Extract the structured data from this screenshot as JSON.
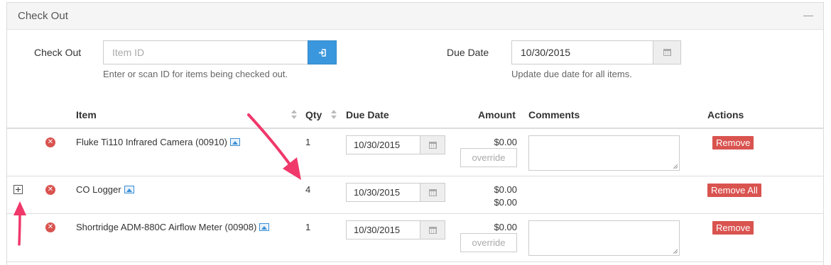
{
  "panel": {
    "title": "Check Out"
  },
  "form": {
    "checkout_label": "Check Out",
    "item_placeholder": "Item ID",
    "item_help": "Enter or scan ID for items being checked out.",
    "due_label": "Due Date",
    "due_value": "10/30/2015",
    "due_help": "Update due date for all items."
  },
  "table": {
    "headers": {
      "item": "Item",
      "qty": "Qty",
      "due": "Due Date",
      "amount": "Amount",
      "comments": "Comments",
      "actions": "Actions"
    },
    "rows": [
      {
        "name": "Fluke Ti110 Infrared Camera (00910)",
        "qty": "1",
        "due": "10/30/2015",
        "amount": "$0.00",
        "override": "override",
        "action": "Remove"
      },
      {
        "name": "CO Logger",
        "qty": "4",
        "due": "10/30/2015",
        "amount": "$0.00",
        "amount2": "$0.00",
        "action": "Remove All"
      },
      {
        "name": "Shortridge ADM-880C Airflow Meter (00908)",
        "qty": "1",
        "due": "10/30/2015",
        "amount": "$0.00",
        "override": "override",
        "action": "Remove"
      }
    ]
  },
  "colors": {
    "primary": "#3b97dd",
    "danger": "#d9534f",
    "annotation": "#f0386b"
  },
  "icons": [
    "minus-icon",
    "sign-in-icon",
    "calendar-icon",
    "remove-circle-icon",
    "image-icon",
    "expand-plus-icon",
    "sort-icon"
  ]
}
